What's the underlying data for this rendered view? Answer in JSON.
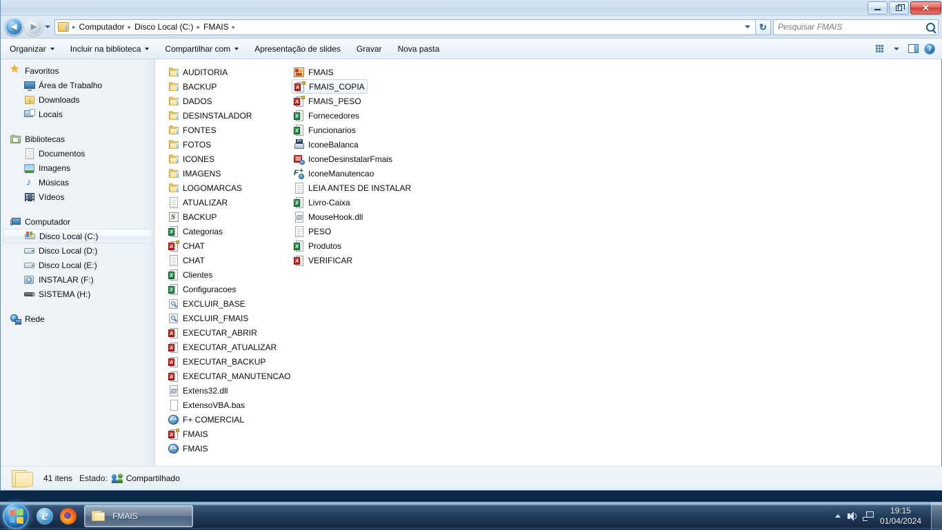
{
  "window": {
    "minimize_label": "Minimizar",
    "maximize_label": "Maximizar",
    "close_label": "Fechar"
  },
  "address_bar": {
    "back_label": "Voltar",
    "forward_label": "Avançar",
    "history_label": "Páginas recentes",
    "refresh_label": "Atualizar",
    "breadcrumbs": [
      "Computador",
      "Disco Local (C:)",
      "FMAIS"
    ],
    "separator": "▸"
  },
  "search": {
    "placeholder": "Pesquisar FMAIS",
    "value": ""
  },
  "toolbar": {
    "items": [
      {
        "label": "Organizar",
        "has_caret": true
      },
      {
        "label": "Incluir na biblioteca",
        "has_caret": true
      },
      {
        "label": "Compartilhar com",
        "has_caret": true
      },
      {
        "label": "Apresentação de slides",
        "has_caret": false
      },
      {
        "label": "Gravar",
        "has_caret": false
      },
      {
        "label": "Nova pasta",
        "has_caret": false
      }
    ],
    "view_label": "Alterar sua visualização",
    "pane_label": "Mostrar o painel de visualização",
    "help_label": "Obter ajuda"
  },
  "navigation_pane": {
    "groups": [
      {
        "header": {
          "label": "Favoritos",
          "icon": "star-icon"
        },
        "items": [
          {
            "label": "Área de Trabalho",
            "icon": "desktop-icon"
          },
          {
            "label": "Downloads",
            "icon": "downloads-folder-icon"
          },
          {
            "label": "Locais",
            "icon": "recent-places-icon"
          }
        ]
      },
      {
        "header": {
          "label": "Bibliotecas",
          "icon": "library-icon"
        },
        "items": [
          {
            "label": "Documentos",
            "icon": "document-icon"
          },
          {
            "label": "Imagens",
            "icon": "pictures-icon"
          },
          {
            "label": "Músicas",
            "icon": "music-note-icon"
          },
          {
            "label": "Vídeos",
            "icon": "video-icon"
          }
        ]
      },
      {
        "header": {
          "label": "Computador",
          "icon": "computer-icon"
        },
        "items": [
          {
            "label": "Disco Local (C:)",
            "icon": "windows-drive-icon",
            "selected": true
          },
          {
            "label": "Disco Local (D:)",
            "icon": "hard-drive-icon"
          },
          {
            "label": "Disco Local (E:)",
            "icon": "hard-drive-icon"
          },
          {
            "label": "INSTALAR (F:)",
            "icon": "cd-drive-icon"
          },
          {
            "label": "SISTEMA (H:)",
            "icon": "removable-drive-icon"
          }
        ]
      },
      {
        "header": {
          "label": "Rede",
          "icon": "network-icon"
        },
        "items": []
      }
    ]
  },
  "file_list": {
    "column1": [
      {
        "name": "AUDITORIA",
        "icon": "folder-icon"
      },
      {
        "name": "BACKUP",
        "icon": "folder-icon"
      },
      {
        "name": "DADOS",
        "icon": "folder-icon"
      },
      {
        "name": "DESINSTALADOR",
        "icon": "folder-icon"
      },
      {
        "name": "FONTES",
        "icon": "folder-icon"
      },
      {
        "name": "FOTOS",
        "icon": "folder-icon"
      },
      {
        "name": "ICONES",
        "icon": "folder-icon"
      },
      {
        "name": "IMAGENS",
        "icon": "folder-icon"
      },
      {
        "name": "LOGOMARCAS",
        "icon": "folder-icon"
      },
      {
        "name": "ATUALIZAR",
        "icon": "text-document-icon"
      },
      {
        "name": "BACKUP",
        "icon": "vbscript-icon"
      },
      {
        "name": "Categorias",
        "icon": "excel-icon"
      },
      {
        "name": "CHAT",
        "icon": "access-locked-icon"
      },
      {
        "name": "CHAT",
        "icon": "text-document-icon"
      },
      {
        "name": "Clientes",
        "icon": "excel-icon"
      },
      {
        "name": "Configuracoes",
        "icon": "excel-icon"
      },
      {
        "name": "EXCLUIR_BASE",
        "icon": "search-script-icon"
      },
      {
        "name": "EXCLUIR_FMAIS",
        "icon": "search-script-icon"
      },
      {
        "name": "EXECUTAR_ABRIR",
        "icon": "access-icon"
      },
      {
        "name": "EXECUTAR_ATUALIZAR",
        "icon": "access-icon"
      },
      {
        "name": "EXECUTAR_BACKUP",
        "icon": "access-icon"
      },
      {
        "name": "EXECUTAR_MANUTENCAO",
        "icon": "access-icon"
      },
      {
        "name": "Extens32.dll",
        "icon": "dll-icon"
      },
      {
        "name": "ExtensoVBA.bas",
        "icon": "blank-document-icon"
      },
      {
        "name": "F+ COMERCIAL",
        "icon": "fplus-app-icon"
      },
      {
        "name": "FMAIS",
        "icon": "access-locked-icon"
      },
      {
        "name": "FMAIS",
        "icon": "fplus-app-icon"
      }
    ],
    "column2": [
      {
        "name": "FMAIS",
        "icon": "image-thumbnail-icon"
      },
      {
        "name": "FMAIS_COPIA",
        "icon": "access-locked-icon",
        "selected": true
      },
      {
        "name": "FMAIS_PESO",
        "icon": "access-locked-icon"
      },
      {
        "name": "Fornecedores",
        "icon": "excel-icon"
      },
      {
        "name": "Funcionarios",
        "icon": "excel-icon"
      },
      {
        "name": "IconeBalanca",
        "icon": "balance-icon"
      },
      {
        "name": "IconeDesinstalarFmais",
        "icon": "uninstall-icon"
      },
      {
        "name": "IconeManutencao",
        "icon": "maintenance-icon"
      },
      {
        "name": "LEIA ANTES DE INSTALAR",
        "icon": "text-document-icon"
      },
      {
        "name": "Livro-Caixa",
        "icon": "excel-icon"
      },
      {
        "name": "MouseHook.dll",
        "icon": "dll-icon"
      },
      {
        "name": "PESO",
        "icon": "text-document-icon"
      },
      {
        "name": "Produtos",
        "icon": "excel-icon"
      },
      {
        "name": "VERIFICAR",
        "icon": "access-icon"
      }
    ]
  },
  "status_bar": {
    "item_count": "41 itens",
    "state_label": "Estado:",
    "state_value": "Compartilhado"
  },
  "taskbar": {
    "start_label": "Iniciar",
    "quick_launch": [
      {
        "label": "Internet Explorer",
        "icon": "ie-icon"
      },
      {
        "label": "Mozilla Firefox",
        "icon": "firefox-icon"
      }
    ],
    "tasks": [
      {
        "label": "FMAIS",
        "icon": "folder-icon",
        "active": true
      }
    ],
    "tray": {
      "show_hidden_label": "Mostrar ícones ocultos",
      "volume_label": "Volume",
      "network_label": "Rede",
      "time": "19:15",
      "date": "01/04/2024"
    },
    "show_desktop_label": "Mostrar área de trabalho"
  },
  "colors": {
    "accent": "#1d6aab",
    "excel_green": "#177a3d",
    "access_red": "#a81d17",
    "folder_yellow": "#f2cf6b",
    "close_red": "#cf4039"
  }
}
